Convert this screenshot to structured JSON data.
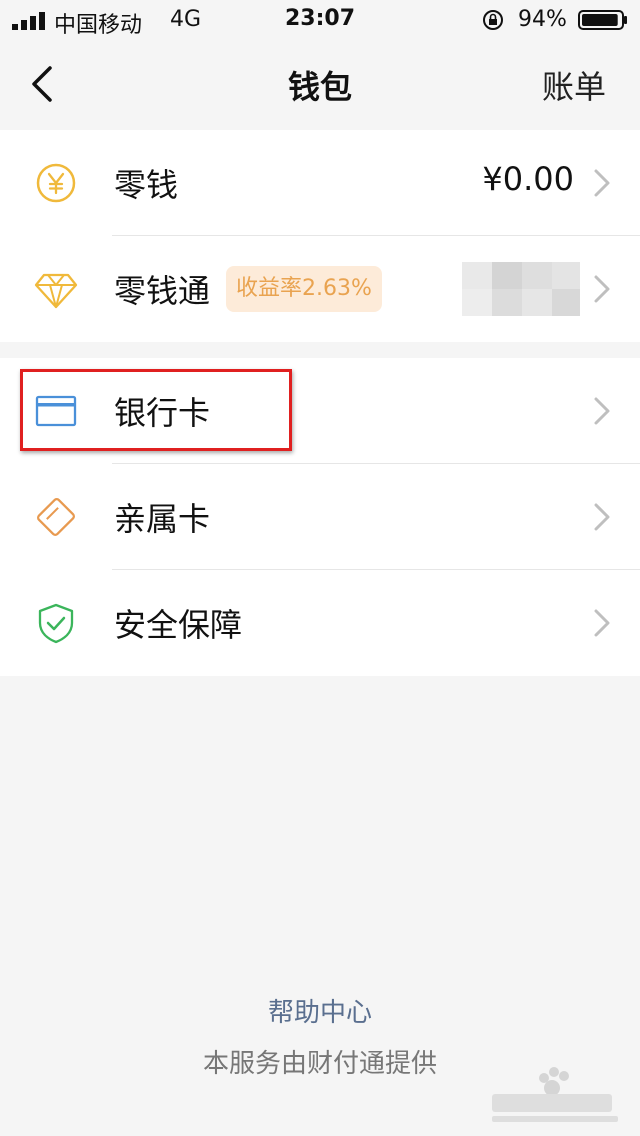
{
  "status_bar": {
    "carrier": "中国移动",
    "network": "4G",
    "time": "23:07",
    "battery_percent": "94%",
    "battery_level": 0.94
  },
  "nav": {
    "title": "钱包",
    "right_action": "账单",
    "back_icon": "chevron-left-icon"
  },
  "sections": {
    "change": {
      "label": "零钱",
      "value": "¥0.00",
      "icon": "yuan-coin-icon",
      "color": "#f0b93b"
    },
    "lingqiantong": {
      "label": "零钱通",
      "badge": "收益率2.63%",
      "icon": "diamond-icon",
      "color": "#f0b93b"
    },
    "bank_card": {
      "label": "银行卡",
      "icon": "card-icon",
      "color": "#4a90d9"
    },
    "family_card": {
      "label": "亲属卡",
      "icon": "family-card-icon",
      "color": "#e89a50"
    },
    "security": {
      "label": "安全保障",
      "icon": "shield-check-icon",
      "color": "#3bb55b"
    }
  },
  "footer": {
    "help": "帮助中心",
    "provider": "本服务由财付通提供"
  },
  "colors": {
    "background": "#f5f5f5",
    "highlight": "#e02020",
    "badge_bg": "#fdebd9",
    "badge_text": "#e9a350",
    "link": "#5a6f8f"
  }
}
